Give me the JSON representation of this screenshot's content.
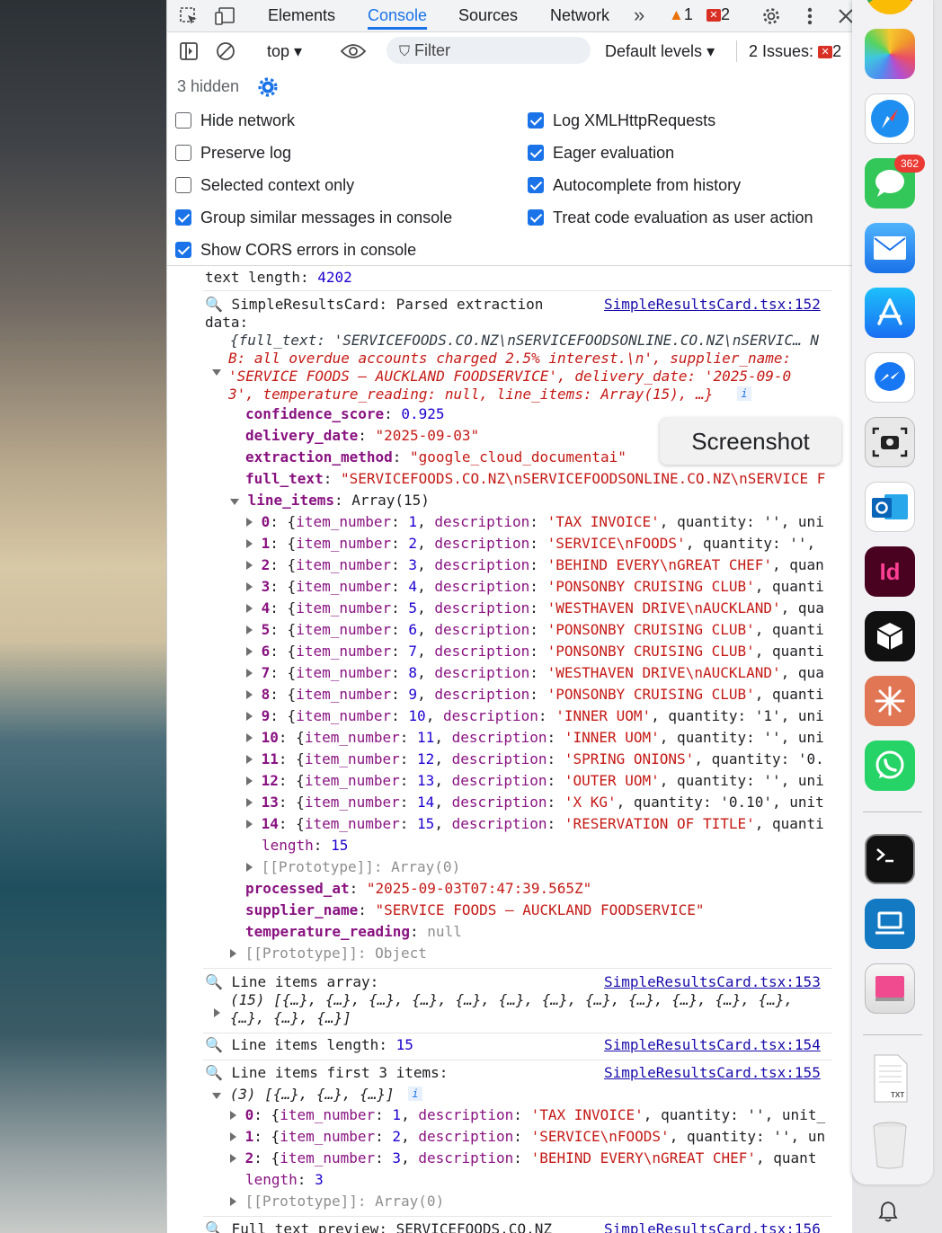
{
  "devtools": {
    "tabs": [
      "Elements",
      "Console",
      "Sources",
      "Network"
    ],
    "active_tab": "Console",
    "more_tabs": "»",
    "warning_count": "1",
    "error_count": "2"
  },
  "toolbar": {
    "context": "top",
    "filter_placeholder": "Filter",
    "levels": "Default levels",
    "issues_label": "2 Issues:",
    "issues_count": "2",
    "hidden_count": "3 hidden"
  },
  "settings": {
    "left": [
      {
        "label": "Hide network",
        "checked": false
      },
      {
        "label": "Preserve log",
        "checked": false
      },
      {
        "label": "Selected context only",
        "checked": false
      },
      {
        "label": "Group similar messages in console",
        "checked": true
      },
      {
        "label": "Show CORS errors in console",
        "checked": true
      }
    ],
    "right": [
      {
        "label": "Log XMLHttpRequests",
        "checked": true
      },
      {
        "label": "Eager evaluation",
        "checked": true
      },
      {
        "label": "Autocomplete from history",
        "checked": true
      },
      {
        "label": "Treat code evaluation as user action",
        "checked": true
      }
    ]
  },
  "console": {
    "text_length_label": "text length:",
    "text_length_value": "4202",
    "msg1": {
      "text": "🔍 SimpleResultsCard: Parsed extraction",
      "text2": "data:",
      "source": "SimpleResultsCard.tsx:152",
      "summary1": "{full_text: 'SERVICEFOODS.CO.NZ\\nSERVICEFOODSONLINE.CO.NZ\\nSERVIC… N",
      "summary2": "B: all overdue accounts charged 2.5% interest.\\n', supplier_name:",
      "summary3": "'SERVICE FOODS – AUCKLAND FOODSERVICE', delivery_date: '2025-09-0",
      "summary4": "3', temperature_reading: null, line_items: Array(15), …}",
      "fields": [
        {
          "key": "confidence_score",
          "value": "0.925",
          "type": "num"
        },
        {
          "key": "delivery_date",
          "value": "\"2025-09-03\"",
          "type": "str"
        },
        {
          "key": "extraction_method",
          "value": "\"google_cloud_documentai\"",
          "type": "str"
        },
        {
          "key": "full_text",
          "value": "\"SERVICEFOODS.CO.NZ\\nSERVICEFOODSONLINE.CO.NZ\\nSERVICE F",
          "type": "str"
        }
      ],
      "line_items_label": "line_items",
      "line_items_type": "Array(15)",
      "items": [
        {
          "i": "0",
          "n": "1",
          "d": "'TAX INVOICE'",
          "rest": ", quantity: '', uni"
        },
        {
          "i": "1",
          "n": "2",
          "d": "'SERVICE\\nFOODS'",
          "rest": ", quantity: '',"
        },
        {
          "i": "2",
          "n": "3",
          "d": "'BEHIND EVERY\\nGREAT CHEF'",
          "rest": ", quan"
        },
        {
          "i": "3",
          "n": "4",
          "d": "'PONSONBY CRUISING CLUB'",
          "rest": ", quanti"
        },
        {
          "i": "4",
          "n": "5",
          "d": "'WESTHAVEN DRIVE\\nAUCKLAND'",
          "rest": ", qua"
        },
        {
          "i": "5",
          "n": "6",
          "d": "'PONSONBY CRUISING CLUB'",
          "rest": ", quanti"
        },
        {
          "i": "6",
          "n": "7",
          "d": "'PONSONBY CRUISING CLUB'",
          "rest": ", quanti"
        },
        {
          "i": "7",
          "n": "8",
          "d": "'WESTHAVEN DRIVE\\nAUCKLAND'",
          "rest": ", qua"
        },
        {
          "i": "8",
          "n": "9",
          "d": "'PONSONBY CRUISING CLUB'",
          "rest": ", quanti"
        },
        {
          "i": "9",
          "n": "10",
          "d": "'INNER UOM'",
          "rest": ", quantity: '1', uni"
        },
        {
          "i": "10",
          "n": "11",
          "d": "'INNER UOM'",
          "rest": ", quantity: '', uni"
        },
        {
          "i": "11",
          "n": "12",
          "d": "'SPRING ONIONS'",
          "rest": ", quantity: '0."
        },
        {
          "i": "12",
          "n": "13",
          "d": "'OUTER UOM'",
          "rest": ", quantity: '', uni"
        },
        {
          "i": "13",
          "n": "14",
          "d": "'X KG'",
          "rest": ", quantity: '0.10', unit"
        },
        {
          "i": "14",
          "n": "15",
          "d": "'RESERVATION OF TITLE'",
          "rest": ", quanti"
        }
      ],
      "length_key": "length",
      "length_value": "15",
      "proto_array": "[[Prototype]]: Array(0)",
      "processed_at_key": "processed_at",
      "processed_at_value": "\"2025-09-03T07:47:39.565Z\"",
      "supplier_key": "supplier_name",
      "supplier_value": "\"SERVICE FOODS – AUCKLAND FOODSERVICE\"",
      "temp_key": "temperature_reading",
      "temp_value": "null",
      "proto_object": "[[Prototype]]: Object"
    },
    "msg2": {
      "text": "🔍 Line items array:",
      "source": "SimpleResultsCard.tsx:153",
      "line1": "(15) [{…}, {…}, {…}, {…}, {…}, {…}, {…}, {…}, {…}, {…}, {…}, {…},",
      "line2": "{…}, {…}, {…}]"
    },
    "msg3": {
      "text": "🔍 Line items length:",
      "value": "15",
      "source": "SimpleResultsCard.tsx:154"
    },
    "msg4": {
      "text": "🔍 Line items first 3 items:",
      "source": "SimpleResultsCard.tsx:155",
      "summary": "(3) [{…}, {…}, {…}]",
      "items": [
        {
          "i": "0",
          "n": "1",
          "d": "'TAX INVOICE'",
          "rest": ", quantity: '', unit_"
        },
        {
          "i": "1",
          "n": "2",
          "d": "'SERVICE\\nFOODS'",
          "rest": ", quantity: '', un"
        },
        {
          "i": "2",
          "n": "3",
          "d": "'BEHIND EVERY\\nGREAT CHEF'",
          "rest": ", quant"
        }
      ],
      "length_key": "length",
      "length_value": "3",
      "proto_array": "[[Prototype]]: Array(0)"
    },
    "msg5": {
      "text": "🔍 Full text preview: SERVICEFOODS.CO.NZ",
      "source": "SimpleResultsCard.tsx:156"
    }
  },
  "tooltip": "Screenshot",
  "dock": {
    "messages_badge": "362",
    "indesign_label": "Id"
  }
}
